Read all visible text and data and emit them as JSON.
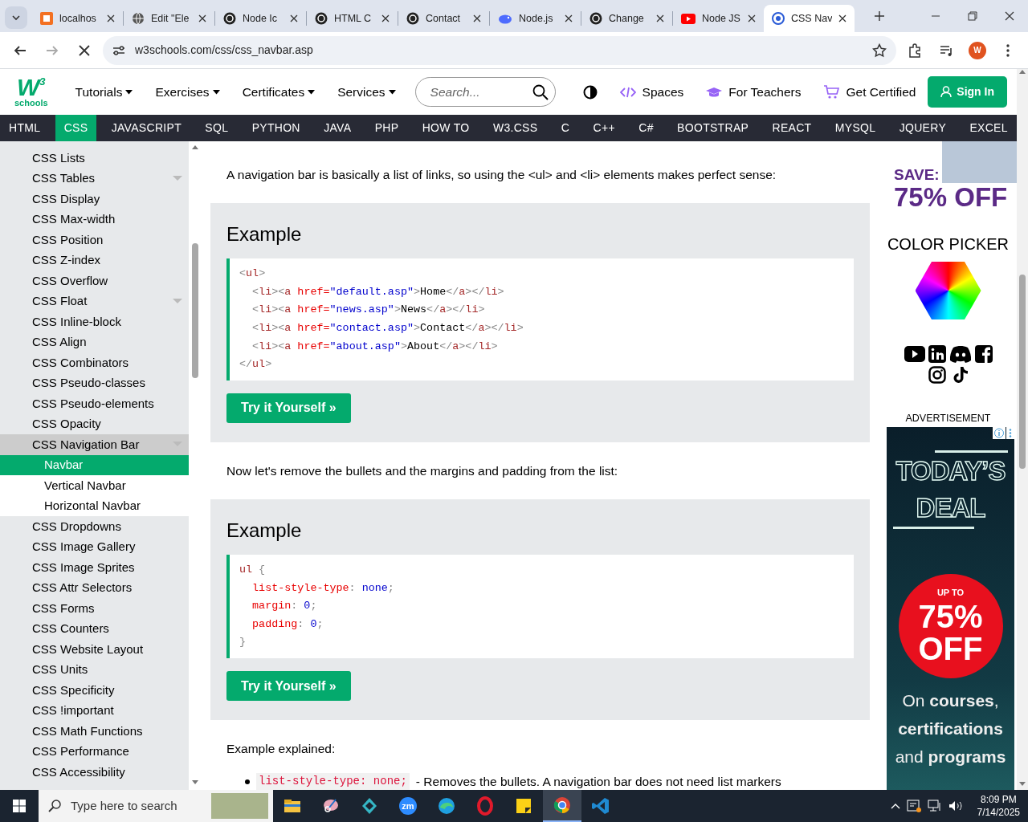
{
  "browser": {
    "tabs": [
      {
        "title": "localhos",
        "selected": false
      },
      {
        "title": "Edit \"Ele",
        "selected": false
      },
      {
        "title": "Node Ic",
        "selected": false
      },
      {
        "title": "HTML C",
        "selected": false
      },
      {
        "title": "Contact",
        "selected": false
      },
      {
        "title": "Node.js",
        "selected": false
      },
      {
        "title": "Change",
        "selected": false
      },
      {
        "title": "Node JS",
        "selected": false
      },
      {
        "title": "CSS Nav",
        "selected": true
      }
    ],
    "url": "w3schools.com/css/css_navbar.asp",
    "profile_initial": "W"
  },
  "header": {
    "logo": {
      "mark": "W$^{3}$",
      "name": "schools"
    },
    "menus": [
      {
        "label": "Tutorials"
      },
      {
        "label": "Exercises"
      },
      {
        "label": "Certificates"
      },
      {
        "label": "Services"
      }
    ],
    "search": {
      "placeholder": "Search..."
    },
    "links": [
      {
        "label": "Spaces",
        "kind": "code"
      },
      {
        "label": "For Teachers",
        "kind": "cap"
      },
      {
        "label": "Get Certified",
        "kind": "cart"
      }
    ],
    "sign_in": "Sign In"
  },
  "topnav": [
    {
      "label": "HTML",
      "selected": false
    },
    {
      "label": "CSS",
      "selected": true
    },
    {
      "label": "JAVASCRIPT",
      "selected": false
    },
    {
      "label": "SQL",
      "selected": false
    },
    {
      "label": "PYTHON",
      "selected": false
    },
    {
      "label": "JAVA",
      "selected": false
    },
    {
      "label": "PHP",
      "selected": false
    },
    {
      "label": "HOW TO",
      "selected": false
    },
    {
      "label": "W3.CSS",
      "selected": false
    },
    {
      "label": "C",
      "selected": false
    },
    {
      "label": "C++",
      "selected": false
    },
    {
      "label": "C#",
      "selected": false
    },
    {
      "label": "BOOTSTRAP",
      "selected": false
    },
    {
      "label": "REACT",
      "selected": false
    },
    {
      "label": "MYSQL",
      "selected": false
    },
    {
      "label": "JQUERY",
      "selected": false
    },
    {
      "label": "EXCEL",
      "selected": false
    }
  ],
  "sidebar": {
    "items": [
      {
        "label": "CSS Lists",
        "selected": false,
        "has_submenu": false,
        "expanded": false
      },
      {
        "label": "CSS Tables",
        "selected": false,
        "has_submenu": true,
        "expanded": false
      },
      {
        "label": "CSS Display",
        "selected": false,
        "has_submenu": false,
        "expanded": false
      },
      {
        "label": "CSS Max-width",
        "selected": false,
        "has_submenu": false,
        "expanded": false
      },
      {
        "label": "CSS Position",
        "selected": false,
        "has_submenu": false,
        "expanded": false
      },
      {
        "label": "CSS Z-index",
        "selected": false,
        "has_submenu": false,
        "expanded": false
      },
      {
        "label": "CSS Overflow",
        "selected": false,
        "has_submenu": false,
        "expanded": false
      },
      {
        "label": "CSS Float",
        "selected": false,
        "has_submenu": true,
        "expanded": false
      },
      {
        "label": "CSS Inline-block",
        "selected": false,
        "has_submenu": false,
        "expanded": false
      },
      {
        "label": "CSS Align",
        "selected": false,
        "has_submenu": false,
        "expanded": false
      },
      {
        "label": "CSS Combinators",
        "selected": false,
        "has_submenu": false,
        "expanded": false
      },
      {
        "label": "CSS Pseudo-classes",
        "selected": false,
        "has_submenu": false,
        "expanded": false
      },
      {
        "label": "CSS Pseudo-elements",
        "selected": false,
        "has_submenu": false,
        "expanded": false
      },
      {
        "label": "CSS Opacity",
        "selected": false,
        "has_submenu": false,
        "expanded": false
      },
      {
        "label": "CSS Navigation Bar",
        "selected": false,
        "has_submenu": true,
        "expanded": true,
        "children": [
          {
            "label": "Navbar",
            "selected": true
          },
          {
            "label": "Vertical Navbar",
            "selected": false
          },
          {
            "label": "Horizontal Navbar",
            "selected": false
          }
        ]
      },
      {
        "label": "CSS Dropdowns",
        "selected": false,
        "has_submenu": false,
        "expanded": false
      },
      {
        "label": "CSS Image Gallery",
        "selected": false,
        "has_submenu": false,
        "expanded": false
      },
      {
        "label": "CSS Image Sprites",
        "selected": false,
        "has_submenu": false,
        "expanded": false
      },
      {
        "label": "CSS Attr Selectors",
        "selected": false,
        "has_submenu": false,
        "expanded": false
      },
      {
        "label": "CSS Forms",
        "selected": false,
        "has_submenu": false,
        "expanded": false
      },
      {
        "label": "CSS Counters",
        "selected": false,
        "has_submenu": false,
        "expanded": false
      },
      {
        "label": "CSS Website Layout",
        "selected": false,
        "has_submenu": false,
        "expanded": false
      },
      {
        "label": "CSS Units",
        "selected": false,
        "has_submenu": false,
        "expanded": false
      },
      {
        "label": "CSS Specificity",
        "selected": false,
        "has_submenu": false,
        "expanded": false
      },
      {
        "label": "CSS !important",
        "selected": false,
        "has_submenu": false,
        "expanded": false
      },
      {
        "label": "CSS Math Functions",
        "selected": false,
        "has_submenu": false,
        "expanded": false
      },
      {
        "label": "CSS Performance",
        "selected": false,
        "has_submenu": false,
        "expanded": false
      },
      {
        "label": "CSS Accessibility",
        "selected": false,
        "has_submenu": false,
        "expanded": false
      }
    ]
  },
  "content": {
    "blocks": [
      {
        "kind": "paragraph",
        "text": "A navigation bar is basically a list of links, so using the <ul> and <li> elements makes perfect sense:"
      },
      {
        "kind": "example",
        "title": "Example",
        "button": "Try it Yourself »",
        "code": [
          {
            "indented": false,
            "tokens": [
              {
                "kind": "punct",
                "text": "<"
              },
              {
                "kind": "tag",
                "text": "ul"
              },
              {
                "kind": "punct",
                "text": ">"
              }
            ]
          },
          {
            "indented": true,
            "tokens": [
              {
                "kind": "punct",
                "text": "<"
              },
              {
                "kind": "tag",
                "text": "li"
              },
              {
                "kind": "punct",
                "text": ">"
              },
              {
                "kind": "punct",
                "text": "<"
              },
              {
                "kind": "tag",
                "text": "a"
              },
              {
                "kind": "attr",
                "text": " href="
              },
              {
                "kind": "value",
                "text": "\"default.asp\""
              },
              {
                "kind": "punct",
                "text": ">"
              },
              {
                "kind": "plain",
                "text": "Home"
              },
              {
                "kind": "punct",
                "text": "</"
              },
              {
                "kind": "tag",
                "text": "a"
              },
              {
                "kind": "punct",
                "text": ">"
              },
              {
                "kind": "punct",
                "text": "</"
              },
              {
                "kind": "tag",
                "text": "li"
              },
              {
                "kind": "punct",
                "text": ">"
              }
            ]
          },
          {
            "indented": true,
            "tokens": [
              {
                "kind": "punct",
                "text": "<"
              },
              {
                "kind": "tag",
                "text": "li"
              },
              {
                "kind": "punct",
                "text": ">"
              },
              {
                "kind": "punct",
                "text": "<"
              },
              {
                "kind": "tag",
                "text": "a"
              },
              {
                "kind": "attr",
                "text": " href="
              },
              {
                "kind": "value",
                "text": "\"news.asp\""
              },
              {
                "kind": "punct",
                "text": ">"
              },
              {
                "kind": "plain",
                "text": "News"
              },
              {
                "kind": "punct",
                "text": "</"
              },
              {
                "kind": "tag",
                "text": "a"
              },
              {
                "kind": "punct",
                "text": ">"
              },
              {
                "kind": "punct",
                "text": "</"
              },
              {
                "kind": "tag",
                "text": "li"
              },
              {
                "kind": "punct",
                "text": ">"
              }
            ]
          },
          {
            "indented": true,
            "tokens": [
              {
                "kind": "punct",
                "text": "<"
              },
              {
                "kind": "tag",
                "text": "li"
              },
              {
                "kind": "punct",
                "text": ">"
              },
              {
                "kind": "punct",
                "text": "<"
              },
              {
                "kind": "tag",
                "text": "a"
              },
              {
                "kind": "attr",
                "text": " href="
              },
              {
                "kind": "value",
                "text": "\"contact.asp\""
              },
              {
                "kind": "punct",
                "text": ">"
              },
              {
                "kind": "plain",
                "text": "Contact"
              },
              {
                "kind": "punct",
                "text": "</"
              },
              {
                "kind": "tag",
                "text": "a"
              },
              {
                "kind": "punct",
                "text": ">"
              },
              {
                "kind": "punct",
                "text": "</"
              },
              {
                "kind": "tag",
                "text": "li"
              },
              {
                "kind": "punct",
                "text": ">"
              }
            ]
          },
          {
            "indented": true,
            "tokens": [
              {
                "kind": "punct",
                "text": "<"
              },
              {
                "kind": "tag",
                "text": "li"
              },
              {
                "kind": "punct",
                "text": ">"
              },
              {
                "kind": "punct",
                "text": "<"
              },
              {
                "kind": "tag",
                "text": "a"
              },
              {
                "kind": "attr",
                "text": " href="
              },
              {
                "kind": "value",
                "text": "\"about.asp\""
              },
              {
                "kind": "punct",
                "text": ">"
              },
              {
                "kind": "plain",
                "text": "About"
              },
              {
                "kind": "punct",
                "text": "</"
              },
              {
                "kind": "tag",
                "text": "a"
              },
              {
                "kind": "punct",
                "text": ">"
              },
              {
                "kind": "punct",
                "text": "</"
              },
              {
                "kind": "tag",
                "text": "li"
              },
              {
                "kind": "punct",
                "text": ">"
              }
            ]
          },
          {
            "indented": false,
            "tokens": [
              {
                "kind": "punct",
                "text": "</"
              },
              {
                "kind": "tag",
                "text": "ul"
              },
              {
                "kind": "punct",
                "text": ">"
              }
            ]
          }
        ]
      },
      {
        "kind": "paragraph",
        "text": "Now let's remove the bullets and the margins and padding from the list:"
      },
      {
        "kind": "example",
        "title": "Example",
        "button": "Try it Yourself »",
        "code": [
          {
            "indented": false,
            "tokens": [
              {
                "kind": "tag",
                "text": "ul"
              },
              {
                "kind": "punct",
                "text": " {"
              }
            ]
          },
          {
            "indented": true,
            "tokens": [
              {
                "kind": "attr",
                "text": "list-style-type"
              },
              {
                "kind": "punct",
                "text": ":"
              },
              {
                "kind": "value",
                "text": " none"
              },
              {
                "kind": "punct",
                "text": ";"
              }
            ]
          },
          {
            "indented": true,
            "tokens": [
              {
                "kind": "attr",
                "text": "margin"
              },
              {
                "kind": "punct",
                "text": ":"
              },
              {
                "kind": "value",
                "text": " 0"
              },
              {
                "kind": "punct",
                "text": ";"
              }
            ]
          },
          {
            "indented": true,
            "tokens": [
              {
                "kind": "attr",
                "text": "padding"
              },
              {
                "kind": "punct",
                "text": ":"
              },
              {
                "kind": "value",
                "text": " 0"
              },
              {
                "kind": "punct",
                "text": ";"
              }
            ]
          },
          {
            "indented": false,
            "tokens": [
              {
                "kind": "punct",
                "text": "}"
              }
            ]
          }
        ]
      },
      {
        "kind": "paragraph",
        "text": "Example explained:"
      },
      {
        "kind": "bullet",
        "code": "list-style-type: none;",
        "text": "- Removes the bullets. A navigation bar does not need list markers"
      }
    ]
  },
  "right_column": {
    "promo": {
      "save": "SAVE:",
      "discount": "75% OFF"
    },
    "color_picker": "COLOR PICKER",
    "ad_label": "ADVERTISEMENT",
    "ad": {
      "headline": [
        "TODAY’S",
        "DEAL"
      ],
      "badge": [
        "UP TO",
        "75%",
        "OFF"
      ],
      "tagline": "On **courses**, **certifications** and **programs**"
    }
  },
  "taskbar": {
    "search_placeholder": "Type here to search",
    "apps": [
      {
        "selected": false
      },
      {
        "selected": false
      },
      {
        "selected": false
      },
      {
        "selected": false,
        "label": "zm"
      },
      {
        "selected": false
      },
      {
        "selected": false
      },
      {
        "selected": false
      },
      {
        "selected": true
      },
      {
        "selected": false
      }
    ],
    "time": "8:09 PM",
    "date": "7/14/2025"
  }
}
